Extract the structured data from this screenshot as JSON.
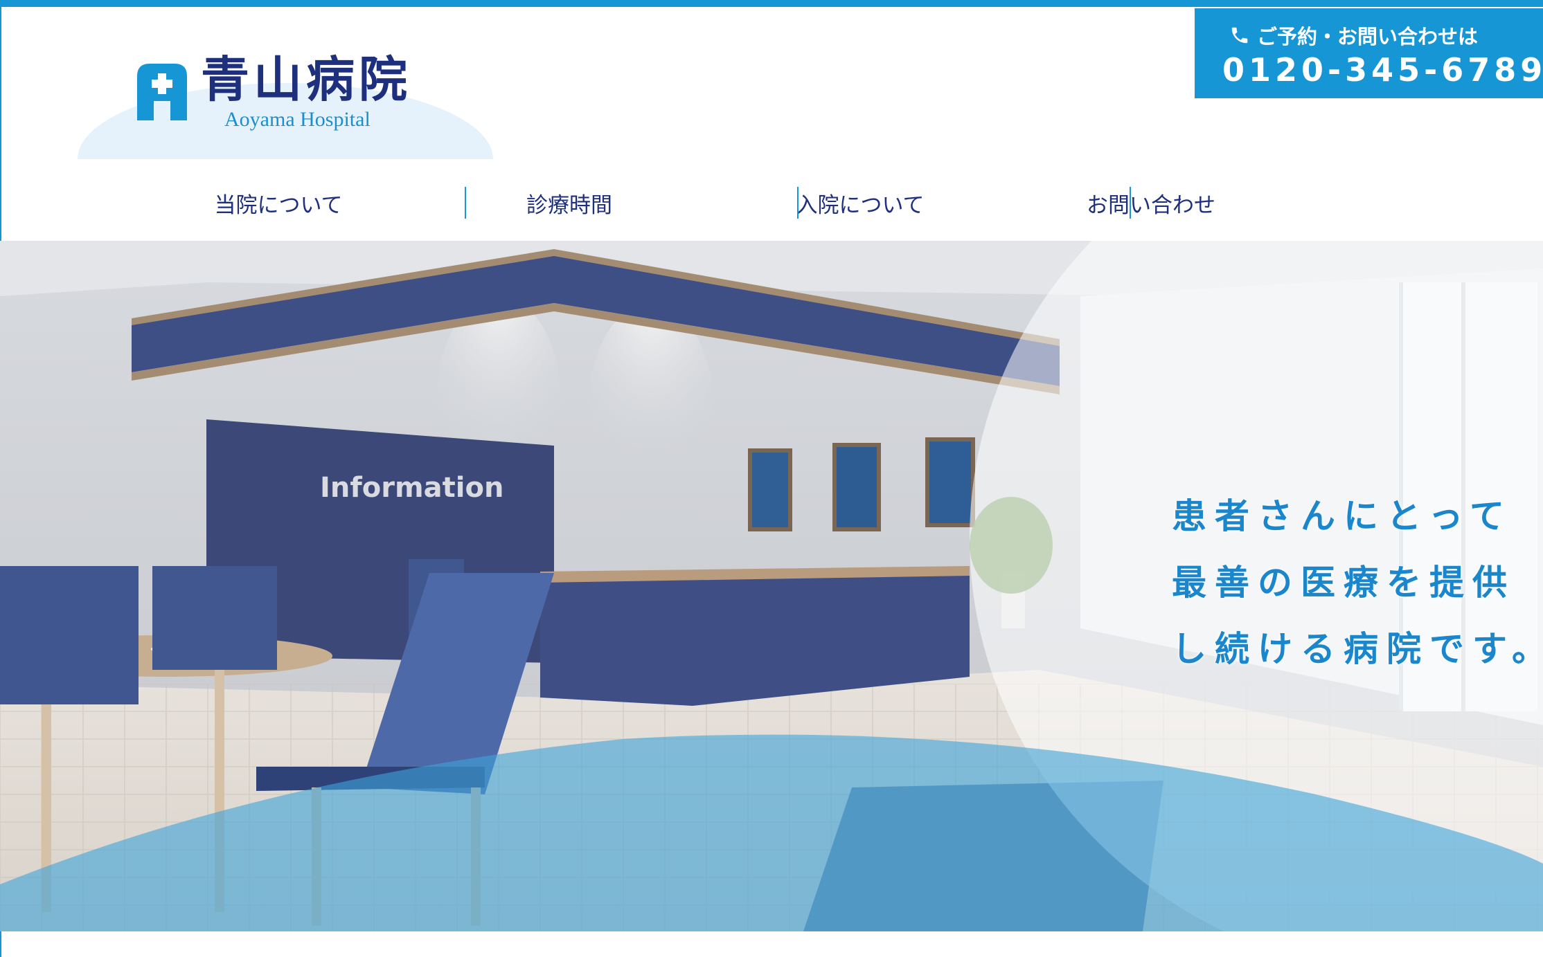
{
  "header": {
    "logo": {
      "name": "青山病院",
      "subtitle": "Aoyama Hospital"
    },
    "contact": {
      "label": "ご予約・お問い合わせは",
      "phone": "0120-345-6789",
      "icon": "phone-icon"
    }
  },
  "nav": {
    "items": [
      {
        "label": "当院について"
      },
      {
        "label": "診療時間"
      },
      {
        "label": "入院について"
      },
      {
        "label": "お問い合わせ"
      }
    ]
  },
  "hero": {
    "sign_text": "Information",
    "tagline": [
      "患者さんにとって",
      "最善の医療を提供",
      "し続ける病院です。"
    ]
  },
  "colors": {
    "accent": "#1796d6",
    "navy": "#1e2f7d",
    "tagline": "#1a86cc"
  }
}
